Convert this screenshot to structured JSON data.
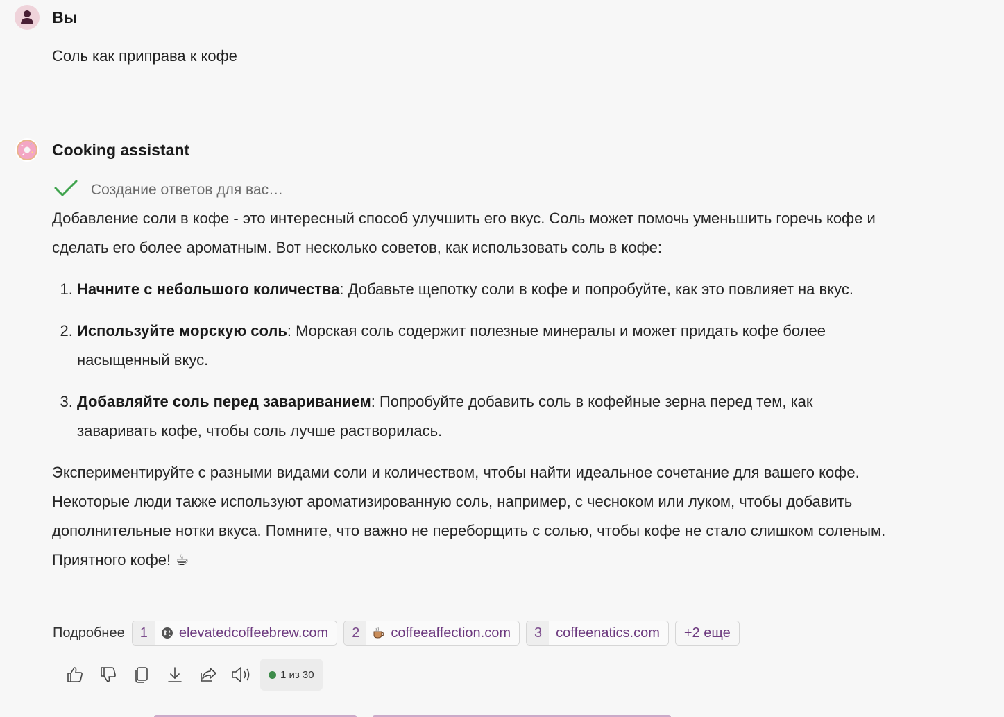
{
  "user": {
    "name": "Вы",
    "message": "Соль как приправа к кофе"
  },
  "assistant": {
    "name": "Cooking assistant",
    "status": "Создание ответов для вас…",
    "intro": "Добавление соли в кофе - это интересный способ улучшить его вкус. Соль может помочь уменьшить горечь кофе и сделать его более ароматным. Вот несколько советов, как использовать соль в кофе:",
    "tips": [
      {
        "title": "Начните с небольшого количества",
        "text": ": Добавьте щепотку соли в кофе и попробуйте, как это повлияет на вкус."
      },
      {
        "title": "Используйте морскую соль",
        "text": ": Морская соль содержит полезные минералы и может придать кофе более насыщенный вкус."
      },
      {
        "title": "Добавляйте соль перед завариванием",
        "text": ": Попробуйте добавить соль в кофейные зерна перед тем, как заваривать кофе, чтобы соль лучше растворилась."
      }
    ],
    "outro": "Экспериментируйте с разными видами соли и количеством, чтобы найти идеальное сочетание для вашего кофе. Некоторые люди также используют ароматизированную соль, например, с чесноком или луком, чтобы добавить дополнительные нотки вкуса. Помните, что важно не переборщить с солью, чтобы кофе не стало слишком соленым. Приятного кофе! ☕"
  },
  "sources": {
    "label": "Подробнее",
    "items": [
      {
        "num": "1",
        "icon": "globe-icon",
        "site": "elevatedcoffeebrew.com"
      },
      {
        "num": "2",
        "icon": "coffee-cup-icon",
        "site": "coffeeaffection.com"
      },
      {
        "num": "3",
        "icon": "none",
        "site": "coffeenatics.com"
      }
    ],
    "more": "+2 еще"
  },
  "toolbar": {
    "counter": "1 из 30",
    "buttons": [
      "thumbs-up-icon",
      "thumbs-down-icon",
      "copy-icon",
      "download-icon",
      "share-icon",
      "speaker-icon"
    ]
  },
  "colors": {
    "background": "#f7f7f7",
    "link": "#6d3a7f",
    "check": "#3fa34d",
    "status_dot": "#3d8b4a"
  }
}
